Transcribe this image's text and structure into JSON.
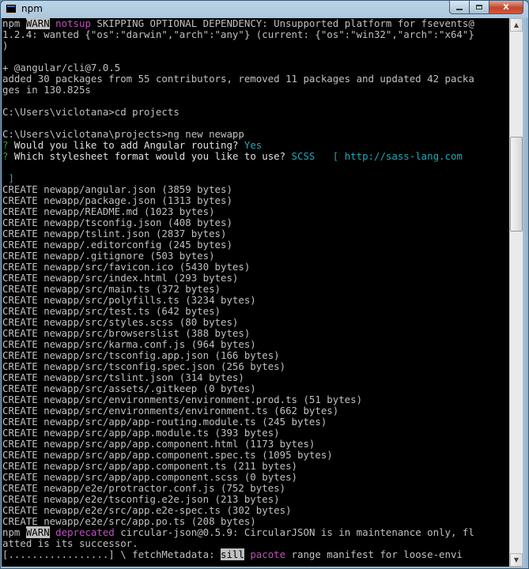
{
  "window": {
    "title": "npm",
    "min_glyph": "",
    "max_glyph": "",
    "close_glyph": "X"
  },
  "colors": {
    "console_bg": "#000000",
    "text": "#c0c0c0",
    "warn_badge_bg": "#c0c0c0",
    "magenta": "#c050c0",
    "cyan": "#1fa9b8",
    "green": "#3a9a3a",
    "titlebar": "#a7c2d9",
    "close_button": "#c4452c"
  },
  "console": {
    "l1": {
      "pre": "npm ",
      "warn": "WARN",
      "sp": " ",
      "tag": "notsup",
      "rest": " SKIPPING OPTIONAL DEPENDENCY: Unsupported platform for fsevents@"
    },
    "l2": "1.2.4: wanted {\"os\":\"darwin\",\"arch\":\"any\"} (current: {\"os\":\"win32\",\"arch\":\"x64\"}",
    "l3": ")",
    "l4": "",
    "l5": "+ @angular/cli@7.0.5",
    "l6": "added 30 packages from 55 contributors, removed 11 packages and updated 42 packa",
    "l7": "ges in 130.825s",
    "l8": "",
    "l9": "C:\\Users\\viclotana>cd projects",
    "l10": "",
    "l11": "C:\\Users\\viclotana\\projects>ng new newapp",
    "l12": {
      "q": "?",
      "text": " Would you like to add Angular routing? ",
      "answer": "Yes"
    },
    "l13": {
      "q": "?",
      "text": " Which stylesheet format would you like to use? ",
      "answer": "SCSS",
      "hint": "   [ http://sass-lang.com"
    },
    "l14": "",
    "l15": " ]",
    "creates": [
      "CREATE newapp/angular.json (3859 bytes)",
      "CREATE newapp/package.json (1313 bytes)",
      "CREATE newapp/README.md (1023 bytes)",
      "CREATE newapp/tsconfig.json (408 bytes)",
      "CREATE newapp/tslint.json (2837 bytes)",
      "CREATE newapp/.editorconfig (245 bytes)",
      "CREATE newapp/.gitignore (503 bytes)",
      "CREATE newapp/src/favicon.ico (5430 bytes)",
      "CREATE newapp/src/index.html (293 bytes)",
      "CREATE newapp/src/main.ts (372 bytes)",
      "CREATE newapp/src/polyfills.ts (3234 bytes)",
      "CREATE newapp/src/test.ts (642 bytes)",
      "CREATE newapp/src/styles.scss (80 bytes)",
      "CREATE newapp/src/browserslist (388 bytes)",
      "CREATE newapp/src/karma.conf.js (964 bytes)",
      "CREATE newapp/src/tsconfig.app.json (166 bytes)",
      "CREATE newapp/src/tsconfig.spec.json (256 bytes)",
      "CREATE newapp/src/tslint.json (314 bytes)",
      "CREATE newapp/src/assets/.gitkeep (0 bytes)",
      "CREATE newapp/src/environments/environment.prod.ts (51 bytes)",
      "CREATE newapp/src/environments/environment.ts (662 bytes)",
      "CREATE newapp/src/app/app-routing.module.ts (245 bytes)",
      "CREATE newapp/src/app/app.module.ts (393 bytes)",
      "CREATE newapp/src/app/app.component.html (1173 bytes)",
      "CREATE newapp/src/app/app.component.spec.ts (1095 bytes)",
      "CREATE newapp/src/app/app.component.ts (211 bytes)",
      "CREATE newapp/src/app/app.component.scss (0 bytes)",
      "CREATE newapp/e2e/protractor.conf.js (752 bytes)",
      "CREATE newapp/e2e/tsconfig.e2e.json (213 bytes)",
      "CREATE newapp/e2e/src/app.e2e-spec.ts (302 bytes)",
      "CREATE newapp/e2e/src/app.po.ts (208 bytes)"
    ],
    "deprecated": {
      "pre": "npm ",
      "warn": "WARN",
      "sp": " ",
      "tag": "deprecated",
      "rest": " circular-json@0.5.9: CircularJSON is in maintenance only, fl"
    },
    "deprecated2": "atted is its successor.",
    "progress": {
      "bar": "[.................] \\ fetchMetadata: ",
      "sill": "sill",
      "sp": " ",
      "pacote": "pacote",
      "rest": " range manifest for loose-envi"
    }
  }
}
